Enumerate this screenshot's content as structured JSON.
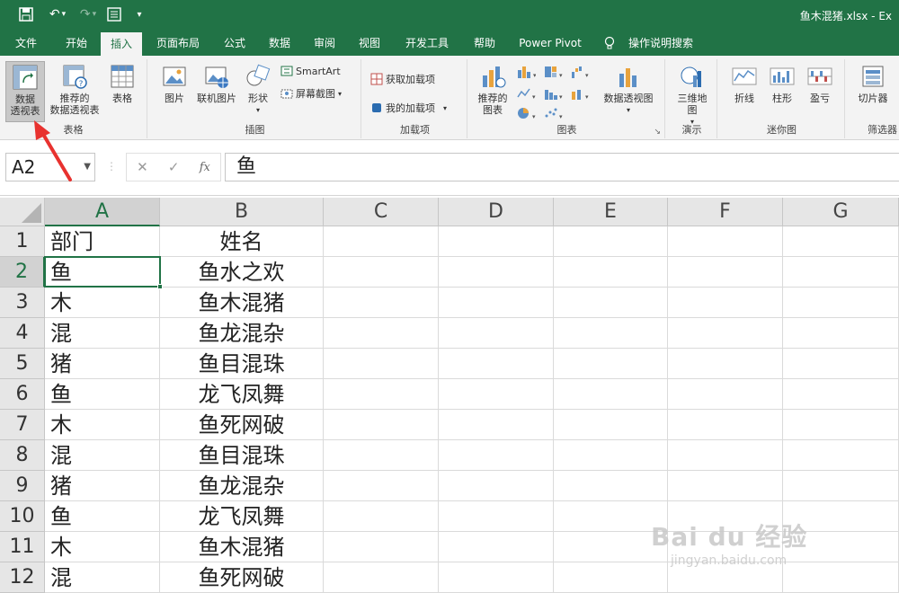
{
  "titlebar": {
    "title": "鱼木混猪.xlsx - Ex"
  },
  "tabs": [
    "文件",
    "开始",
    "插入",
    "页面布局",
    "公式",
    "数据",
    "审阅",
    "视图",
    "开发工具",
    "帮助",
    "Power Pivot",
    "操作说明搜索"
  ],
  "ribbon": {
    "groups": {
      "tables": "表格",
      "illustrations": "插图",
      "addins": "加载项",
      "charts": "图表",
      "tours": "演示",
      "sparklines": "迷你图",
      "filters": "筛选器"
    },
    "buttons": {
      "pivot_table_line1": "数据",
      "pivot_table_line2": "透视表",
      "rec_pivot_line1": "推荐的",
      "rec_pivot_line2": "数据透视表",
      "table": "表格",
      "pictures": "图片",
      "online_pictures": "联机图片",
      "shapes": "形状",
      "smartart": "SmartArt",
      "screenshot": "屏幕截图",
      "get_addins": "获取加载项",
      "my_addins": "我的加载项",
      "rec_charts_line1": "推荐的",
      "rec_charts_line2": "图表",
      "pivot_chart": "数据透视图",
      "map3d_line1": "三维地",
      "map3d_line2": "图",
      "line": "折线",
      "column": "柱形",
      "winloss": "盈亏",
      "slicer": "切片器"
    }
  },
  "formula_bar": {
    "name_box": "A2",
    "fx": "fx",
    "content": "鱼"
  },
  "grid": {
    "columns": [
      "A",
      "B",
      "C",
      "D",
      "E",
      "F",
      "G"
    ],
    "rows": [
      {
        "num": "1",
        "a": "部门",
        "b": "姓名"
      },
      {
        "num": "2",
        "a": "鱼",
        "b": "鱼水之欢"
      },
      {
        "num": "3",
        "a": "木",
        "b": "鱼木混猪"
      },
      {
        "num": "4",
        "a": "混",
        "b": "鱼龙混杂"
      },
      {
        "num": "5",
        "a": "猪",
        "b": "鱼目混珠"
      },
      {
        "num": "6",
        "a": "鱼",
        "b": "龙飞凤舞"
      },
      {
        "num": "7",
        "a": "木",
        "b": "鱼死网破"
      },
      {
        "num": "8",
        "a": "混",
        "b": "鱼目混珠"
      },
      {
        "num": "9",
        "a": "猪",
        "b": "鱼龙混杂"
      },
      {
        "num": "10",
        "a": "鱼",
        "b": "龙飞凤舞"
      },
      {
        "num": "11",
        "a": "木",
        "b": "鱼木混猪"
      },
      {
        "num": "12",
        "a": "混",
        "b": "鱼死网破"
      }
    ],
    "active_cell": "A2"
  },
  "watermark": {
    "brand": "Bai du 经验",
    "url": "jingyan.baidu.com"
  },
  "colors": {
    "accent": "#217346",
    "arrow": "#e8322f"
  }
}
